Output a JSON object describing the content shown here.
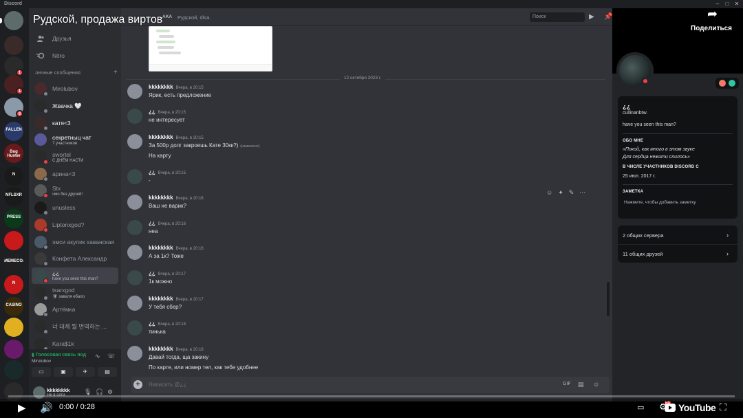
{
  "window": {
    "app_name": "Discord"
  },
  "servers": [
    {
      "label": "",
      "color": "#5d6b6a"
    },
    {
      "label": "",
      "color": "#3a2a2a",
      "badge": ""
    },
    {
      "label": "",
      "color": "#2a2a2a",
      "badge": "1"
    },
    {
      "label": "",
      "color": "#4a2020",
      "badge": "1"
    },
    {
      "label": "",
      "color": "#8a9aa8",
      "badge": "6"
    },
    {
      "label": "FALLEN",
      "color": "#2a3a6a"
    },
    {
      "label": "Bug Hunter",
      "color": "#6a1a1a"
    },
    {
      "label": "N",
      "color": "#1a1a1a"
    },
    {
      "label": "NFLSXR",
      "color": "#1a1a1a"
    },
    {
      "label": "PRESS",
      "color": "#0a3a1a"
    },
    {
      "label": "",
      "color": "#c81a1a"
    },
    {
      "label": "MEMECOIN",
      "color": "#202020"
    },
    {
      "label": "N",
      "color": "#c81a1a"
    },
    {
      "label": "CASINO",
      "color": "#3a2a0a"
    },
    {
      "label": "",
      "color": "#e0b020"
    },
    {
      "label": "",
      "color": "#6a1a6a"
    },
    {
      "label": "",
      "color": "#1a2a2a"
    },
    {
      "label": "",
      "color": "#2a2a2a"
    }
  ],
  "dm_sidebar": {
    "friends_label": "Друзья",
    "nitro_label": "Nitro",
    "section_title": "ЛИЧНЫЕ СООБЩЕНИЯ",
    "add_label": "+",
    "items": [
      {
        "name": "Mirolubov",
        "sub": "",
        "status": "offline",
        "color": "#4a2a2a",
        "bright": false
      },
      {
        "name": "Жвачка 🤍",
        "sub": "",
        "status": "offline",
        "color": "#2a2a2a",
        "bright": true
      },
      {
        "name": "катя<3",
        "sub": "",
        "status": "offline",
        "color": "#3a2a2a",
        "bright": true
      },
      {
        "name": "секретныц чат",
        "sub": "7 участников",
        "status": "none",
        "color": "#5a5a9a",
        "bright": true
      },
      {
        "name": "swortel",
        "sub": "С ДНЁМ НАСТИ",
        "status": "dnd",
        "color": "#2a2a2a",
        "bright": false
      },
      {
        "name": "арина<3",
        "sub": "",
        "status": "offline",
        "color": "#8a6a4a",
        "bright": false
      },
      {
        "name": "Stx",
        "sub": "чмо без друзей!",
        "status": "dnd",
        "color": "#5a5a5a",
        "bright": false
      },
      {
        "name": "unusless",
        "sub": "",
        "status": "offline",
        "color": "#1a1a1a",
        "bright": false
      },
      {
        "name": "Liptonxgod?",
        "sub": "",
        "status": "dnd",
        "color": "#aa3a2a",
        "bright": false
      },
      {
        "name": "эмси акулик хаванская",
        "sub": "",
        "status": "offline",
        "color": "#4a5a6a",
        "bright": false
      },
      {
        "name": "Конфета Александр",
        "sub": "",
        "status": "offline",
        "color": "#3a3a3a",
        "bright": false
      },
      {
        "name": "¿¿",
        "sub": "have you seen this man?",
        "status": "dnd",
        "color": "#3a4a4a",
        "bright": true,
        "active": true
      },
      {
        "name": "tsarxgod",
        "sub": "🛡 заваля ебало",
        "status": "offline",
        "color": "#2a2a2a",
        "bright": false
      },
      {
        "name": "Артёмка",
        "sub": "",
        "status": "offline",
        "color": "#9a9a9a",
        "bright": false
      },
      {
        "name": "너 대제 뭘 번역하는 ...",
        "sub": "",
        "status": "offline",
        "color": "#2a2a2a",
        "bright": false
      },
      {
        "name": "Kara$1k",
        "sub": "",
        "status": "offline",
        "color": "#2a2a2a",
        "bright": false
      }
    ]
  },
  "voice": {
    "title": "Голосовая связь под",
    "sub": "Mirolubov"
  },
  "user_panel": {
    "name": "kkkkkkkk",
    "status": "Не в сети"
  },
  "chat_header": {
    "aka": "AKA",
    "names": "Рудской, dlsa."
  },
  "search": {
    "placeholder": "Поиск"
  },
  "date_divider": "12 октября 2023 г.",
  "messages": [
    {
      "author": "kkkkkkkk",
      "time": "Вчера, в 20:15",
      "lines": [
        "Ярик, есть предложение"
      ],
      "avatar": "#8a8f99"
    },
    {
      "author": "¿¿",
      "time": "Вчера, в 20:15",
      "lines": [
        "не интересует"
      ],
      "avatar": "#3a4a4a"
    },
    {
      "author": "kkkkkkkk",
      "time": "Вчера, в 20:15",
      "lines": [
        "За 500р долг закроешь Кате 30кк?)",
        "На карту"
      ],
      "edited": "(изменено)",
      "avatar": "#8a8f99"
    },
    {
      "author": "¿¿",
      "time": "Вчера, в 20:15",
      "lines": [
        "-"
      ],
      "avatar": "#3a4a4a"
    },
    {
      "author": "kkkkkkkk",
      "time": "Вчера, в 20:16",
      "lines": [
        "Ваш не варик?"
      ],
      "avatar": "#8a8f99"
    },
    {
      "author": "¿¿",
      "time": "Вчера, в 20:16",
      "lines": [
        "неа"
      ],
      "avatar": "#3a4a4a"
    },
    {
      "author": "kkkkkkkk",
      "time": "Вчера, в 20:16",
      "lines": [
        "А за 1к? Тоже"
      ],
      "avatar": "#8a8f99"
    },
    {
      "author": "¿¿",
      "time": "Вчера, в 20:17",
      "lines": [
        "1к можно"
      ],
      "avatar": "#3a4a4a"
    },
    {
      "author": "kkkkkkkk",
      "time": "Вчера, в 20:17",
      "lines": [
        "У тебя сбер?"
      ],
      "avatar": "#8a8f99"
    },
    {
      "author": "¿¿",
      "time": "Вчера, в 20:18",
      "lines": [
        "тинька"
      ],
      "avatar": "#3a4a4a"
    },
    {
      "author": "kkkkkkkk",
      "time": "Вчера, в 20:18",
      "lines": [
        "Давай тогда, ща закину",
        "По карте, или номер тел, как тебе удобнее"
      ],
      "avatar": "#8a8f99"
    }
  ],
  "composer": {
    "placeholder": "Написать @¿¿"
  },
  "profile": {
    "display_name": "¿¿",
    "username": "cullinanbtw.",
    "custom_status": "have you seen this man?",
    "about_title": "ОБО МНЕ",
    "about_lines": [
      "«Покой, как много в этом звуке",
      "Для сердца нежити слилось»"
    ],
    "member_since_title": "В ЧИСЛЕ УЧАСТНИКОВ DISCORD С",
    "member_since": "25 июл. 2017 г.",
    "note_title": "ЗАМЕТКА",
    "note_placeholder": "Нажмите, чтобы добавить заметку",
    "mutual_servers": "2 общих сервера",
    "mutual_friends": "11 общих друзей"
  },
  "youtube": {
    "video_title": "Рудской, продажа виртов",
    "share_label": "Поделиться",
    "time_current": "0:00",
    "time_separator": " / ",
    "time_total": "0:28",
    "progress": 0.0,
    "brand": "YouTube"
  },
  "colors": {
    "accent": "#5865f2",
    "dnd": "#f23f43",
    "online": "#23a55a",
    "yt_red": "#ff0000"
  }
}
